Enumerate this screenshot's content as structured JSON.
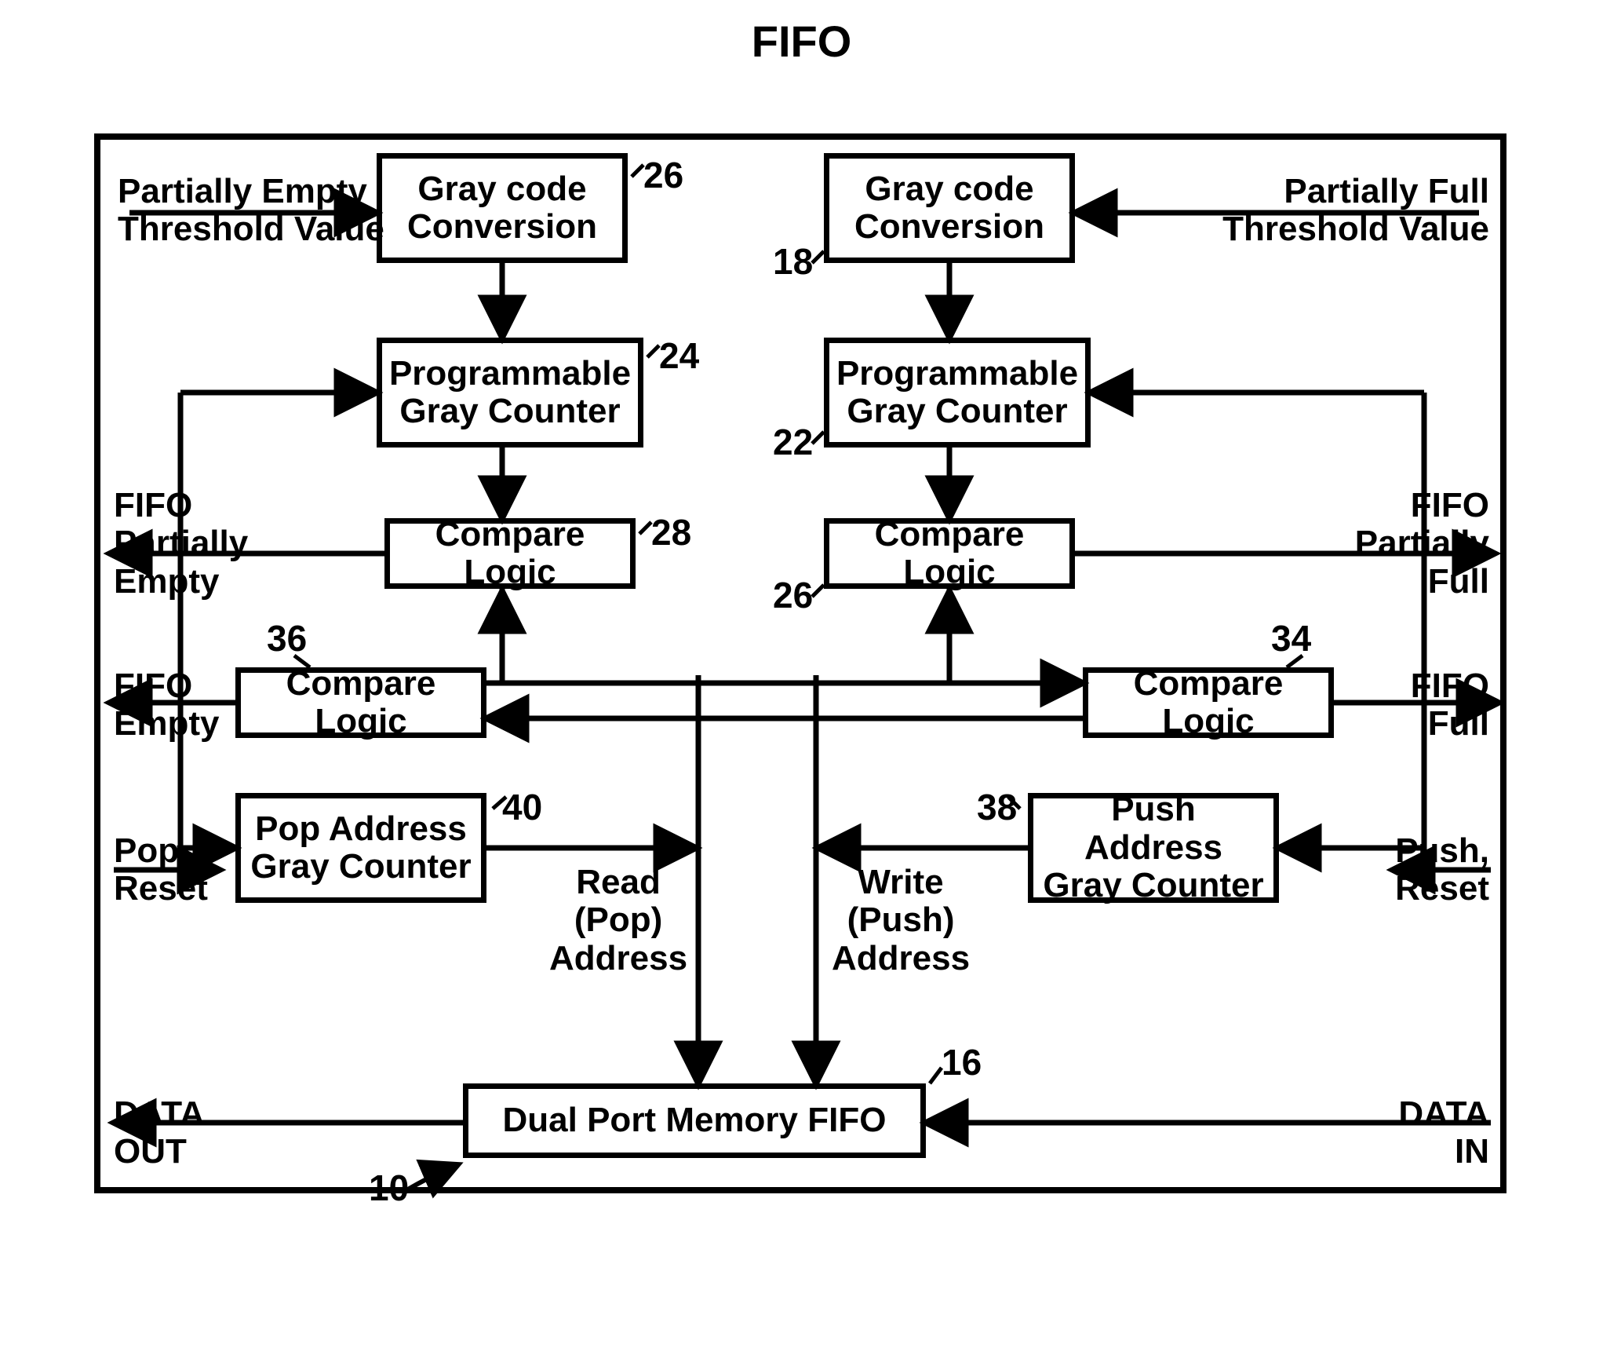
{
  "title": "FIFO",
  "blocks": {
    "gcc_left": "Gray code\nConversion",
    "gcc_right": "Gray code\nConversion",
    "pgc_left": "Programmable\nGray Counter",
    "pgc_right": "Programmable\nGray Counter",
    "cmp_left_top": "Compare Logic",
    "cmp_right_top": "Compare Logic",
    "cmp_left_mid": "Compare Logic",
    "cmp_right_mid": "Compare Logic",
    "pop_addr": "Pop Address\nGray Counter",
    "push_addr": "Push Address\nGray Counter",
    "dpram": "Dual Port Memory  FIFO"
  },
  "labels": {
    "pe_threshold": "Partially Empty\nThreshold Value",
    "pf_threshold": "Partially Full\nThreshold Value",
    "fifo_pe": "FIFO\nPartially\nEmpty",
    "fifo_pf": "FIFO\nPartially\nFull",
    "fifo_empty": "FIFO\nEmpty",
    "fifo_full": "FIFO\nFull",
    "pop_reset": "Pop,\nReset",
    "push_reset": "Push,\nReset",
    "read_addr": "Read\n(Pop)\nAddress",
    "write_addr": "Write\n(Push)\nAddress",
    "data_out": "DATA\nOUT",
    "data_in": "DATA\nIN"
  },
  "refs": {
    "r10": "10",
    "r16": "16",
    "r18": "18",
    "r22": "22",
    "r24": "24",
    "r26a": "26",
    "r26b": "26",
    "r28": "28",
    "r34": "34",
    "r36": "36",
    "r38": "38",
    "r40": "40"
  }
}
